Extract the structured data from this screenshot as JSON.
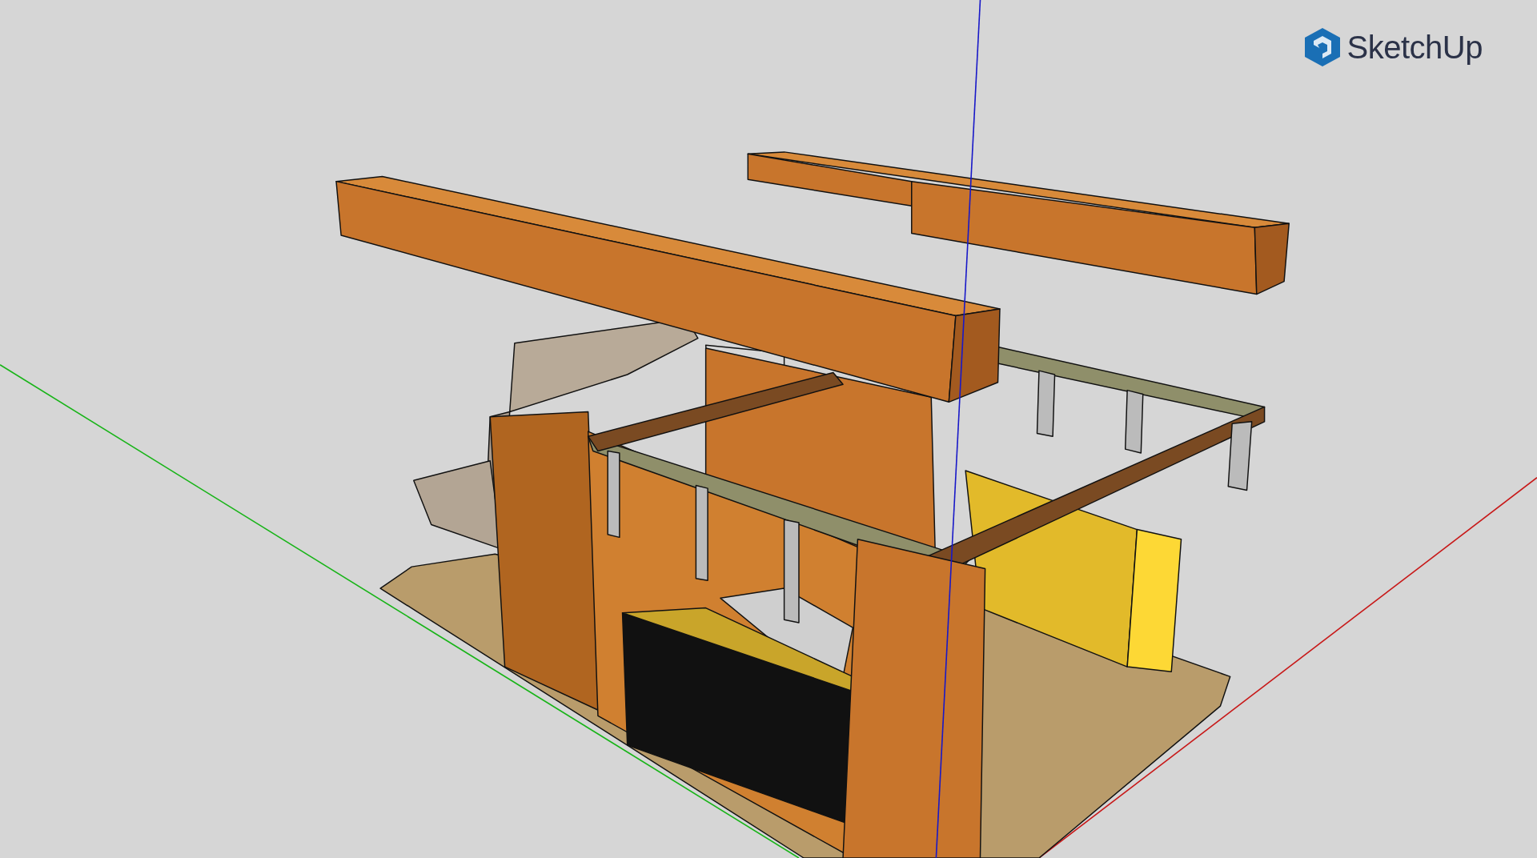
{
  "logo": {
    "text": "SketchUp"
  }
}
